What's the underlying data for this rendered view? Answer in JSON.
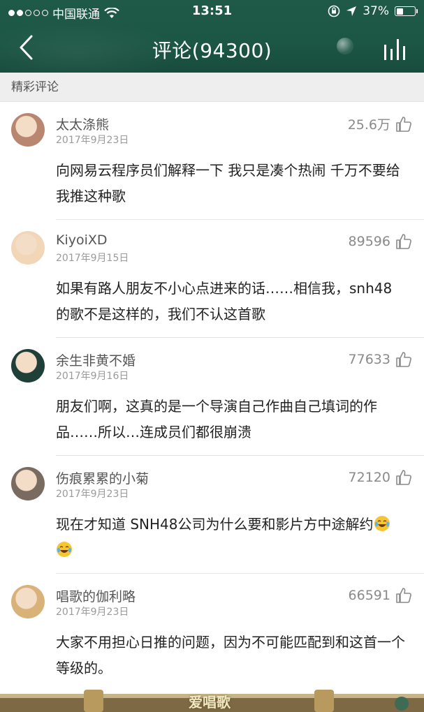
{
  "status_bar": {
    "carrier": "中国联通",
    "time": "13:51",
    "battery": "37%",
    "battery_level": 0.37,
    "signal_bars": 2,
    "signal_total": 5
  },
  "nav": {
    "title": "评论(94300)",
    "back_icon": "chevron-left-icon",
    "right_icon": "bars-icon"
  },
  "section": {
    "title": "精彩评论"
  },
  "comments": [
    {
      "user": "太太涤熊",
      "date": "2017年9月23日",
      "likes": "25.6万",
      "text": "向网易云程序员们解释一下 我只是凑个热闹 千万不要给我推这种歌",
      "avatar_color": "#b98670"
    },
    {
      "user": "KiyoiXD",
      "date": "2017年9月15日",
      "likes": "89596",
      "text": "如果有路人朋友不小心点进来的话……相信我，snh48的歌不是这样的，我们不认这首歌",
      "avatar_color": "#f2d6b8"
    },
    {
      "user": "余生非黄不婚",
      "date": "2017年9月16日",
      "likes": "77633",
      "text": "朋友们啊，这真的是一个导演自己作曲自己填词的作品……所以…连成员们都很崩溃",
      "avatar_color": "#1f3f38"
    },
    {
      "user": "伤痕累累的小菊",
      "date": "2017年9月23日",
      "likes": "72120",
      "text": "现在才知道 SNH48公司为什么要和影片方中途解约",
      "avatar_color": "#7a6b60",
      "emoji_count": 2
    },
    {
      "user": "唱歌的伽利略",
      "date": "2017年9月23日",
      "likes": "66591",
      "text": "大家不用担心日推的问题，因为不可能匹配到和这首一个等级的。",
      "avatar_color": "#d9b27a"
    }
  ],
  "watermark": "爱唱歌",
  "colors": {
    "header": "#1c5645",
    "section_bg": "#eeeeee",
    "text": "#222222",
    "meta": "#9a9a9a"
  }
}
